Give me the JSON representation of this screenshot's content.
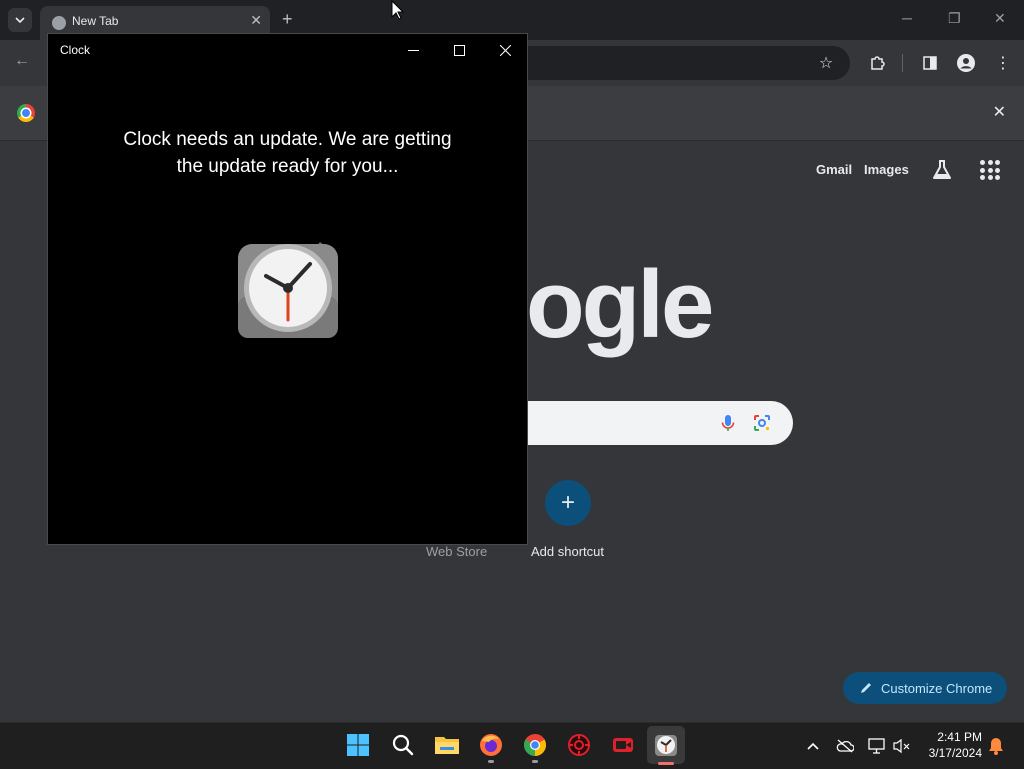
{
  "browser": {
    "tab_title": "New Tab",
    "ntp": {
      "links": [
        "Gmail",
        "Images"
      ],
      "logo_text": "ogle",
      "shortcuts": [
        {
          "label": "Web Store"
        },
        {
          "label": "Add shortcut"
        }
      ],
      "customize_label": "Customize Chrome"
    }
  },
  "clock_window": {
    "title": "Clock",
    "message_line1": "Clock needs an update. We are getting",
    "message_line2": "the update ready for you..."
  },
  "taskbar": {
    "apps": [
      "start-icon",
      "search-icon",
      "file-explorer-icon",
      "firefox-icon",
      "chrome-icon",
      "settings-gear-icon",
      "recorder-icon",
      "clock-app-icon"
    ],
    "time": "2:41 PM",
    "date": "3/17/2024"
  },
  "colors": {
    "chrome_bg": "#35363a",
    "accent": "#0b4f7a",
    "clock_bg": "#000000"
  }
}
